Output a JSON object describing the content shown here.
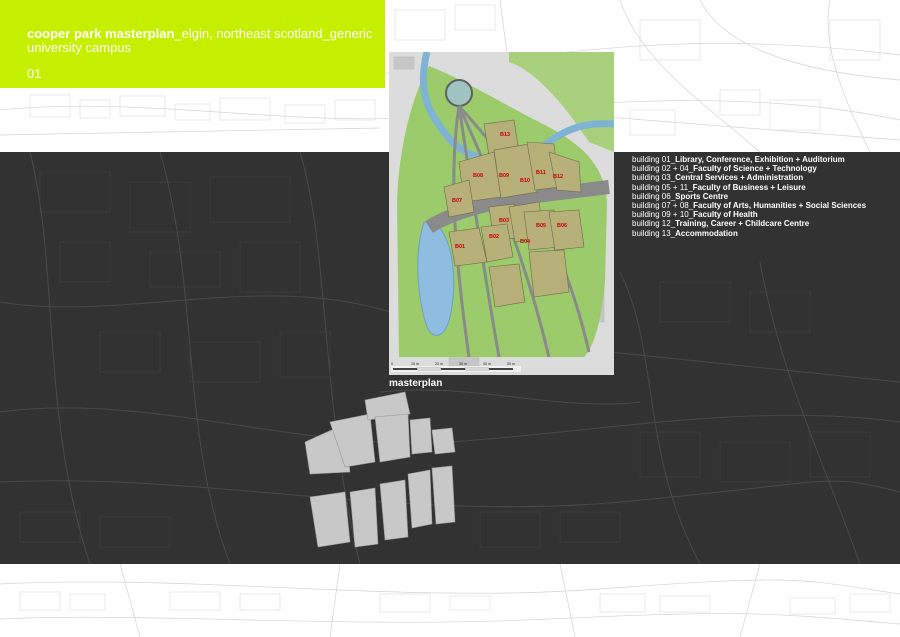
{
  "header": {
    "title_bold": "cooper park masterplan",
    "title_rest": "_elgin, northeast scotland_generic",
    "title_line2": "university campus",
    "page_number": "01",
    "accent_color": "#c4f000"
  },
  "masterplan": {
    "caption": "masterplan",
    "building_labels": [
      "B01",
      "B02",
      "B03",
      "B04",
      "B05",
      "B06",
      "B07",
      "B08",
      "B09",
      "B10",
      "B11",
      "B12",
      "B13"
    ],
    "scale_bar": [
      "0",
      "10 m",
      "20 m",
      "30 m",
      "40 m",
      "50 m"
    ]
  },
  "legend": [
    {
      "prefix": "building 01_",
      "name": "Library, Conference, Exhibition + Auditorium"
    },
    {
      "prefix": "building 02 + 04_",
      "name": "Faculty of Science + Technology"
    },
    {
      "prefix": "building 03_",
      "name": "Central Services + Administration"
    },
    {
      "prefix": "building 05 + 11_",
      "name": "Faculty of Business + Leisure"
    },
    {
      "prefix": "building 06_",
      "name": "Sports Centre"
    },
    {
      "prefix": "building 07 + 08_",
      "name": "Faculty of Arts, Humanities + Social Sciences"
    },
    {
      "prefix": "building 09 + 10_",
      "name": "Faculty of Health"
    },
    {
      "prefix": "building 12_",
      "name": "Training, Career + Childcare Centre"
    },
    {
      "prefix": "building 13_",
      "name": "Accommodation"
    }
  ],
  "colors": {
    "dark_band": "#323232",
    "grass": "#9bcb6b",
    "river": "#7fb3d6",
    "building_fill": "#b8b079",
    "label_red": "#cc0000"
  }
}
